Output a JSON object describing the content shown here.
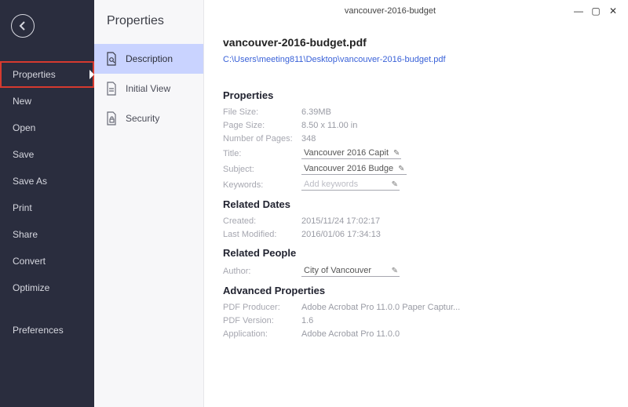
{
  "titlebar": {
    "document": "vancouver-2016-budget"
  },
  "rail": {
    "items": [
      {
        "label": "Properties",
        "active": true
      },
      {
        "label": "New"
      },
      {
        "label": "Open"
      },
      {
        "label": "Save"
      },
      {
        "label": "Save As"
      },
      {
        "label": "Print"
      },
      {
        "label": "Share"
      },
      {
        "label": "Convert"
      },
      {
        "label": "Optimize"
      }
    ],
    "footer": {
      "label": "Preferences"
    }
  },
  "subpanel": {
    "title": "Properties",
    "items": [
      {
        "label": "Description",
        "selected": true
      },
      {
        "label": "Initial View"
      },
      {
        "label": "Security"
      }
    ]
  },
  "doc": {
    "filename": "vancouver-2016-budget.pdf",
    "path": "C:\\Users\\meeting811\\Desktop\\vancouver-2016-budget.pdf"
  },
  "properties": {
    "heading": "Properties",
    "file_size_label": "File Size:",
    "file_size": "6.39MB",
    "page_size_label": "Page Size:",
    "page_size": "8.50 x 11.00 in",
    "pages_label": "Number of Pages:",
    "pages": "348",
    "title_label": "Title:",
    "title": "Vancouver 2016 Capit",
    "subject_label": "Subject:",
    "subject": "Vancouver 2016 Budge",
    "keywords_label": "Keywords:",
    "keywords_placeholder": "Add keywords"
  },
  "dates": {
    "heading": "Related Dates",
    "created_label": "Created:",
    "created": "2015/11/24 17:02:17",
    "modified_label": "Last Modified:",
    "modified": "2016/01/06 17:34:13"
  },
  "people": {
    "heading": "Related People",
    "author_label": "Author:",
    "author": "City of Vancouver"
  },
  "advanced": {
    "heading": "Advanced Properties",
    "producer_label": "PDF Producer:",
    "producer": "Adobe Acrobat Pro 11.0.0 Paper Captur...",
    "version_label": "PDF Version:",
    "version": "1.6",
    "application_label": "Application:",
    "application": "Adobe Acrobat Pro 11.0.0"
  }
}
